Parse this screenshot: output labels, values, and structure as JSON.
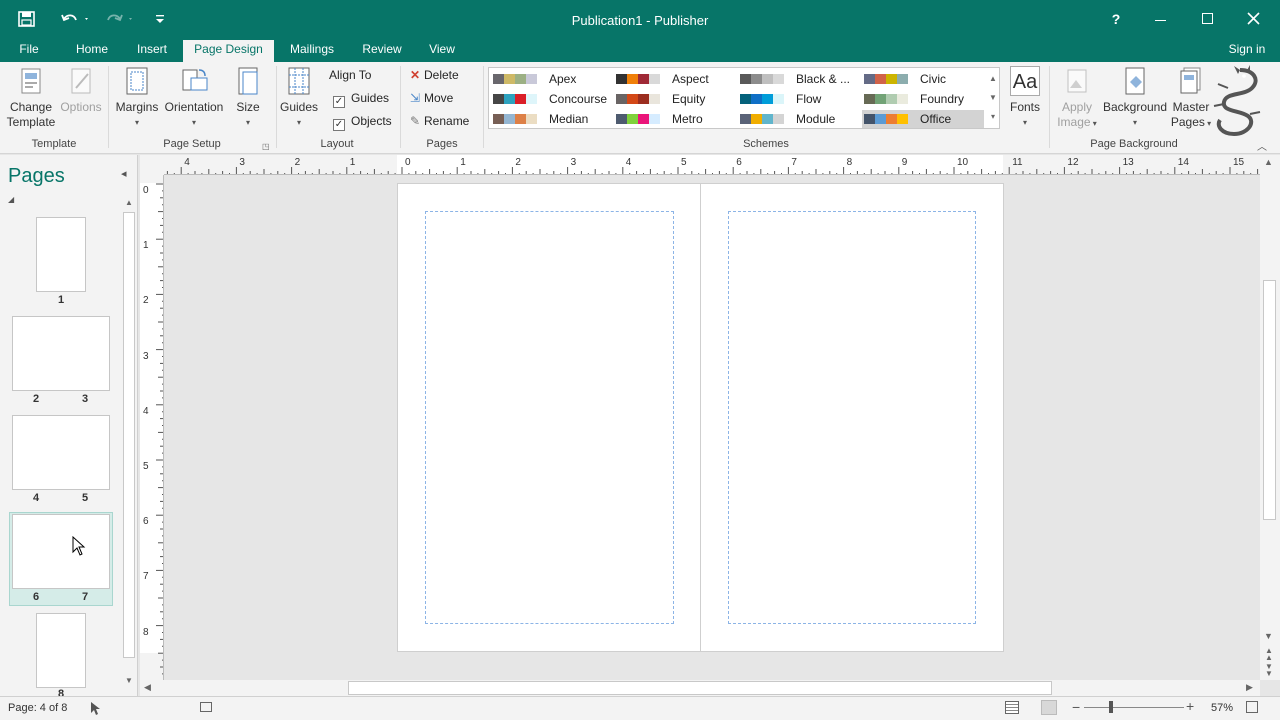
{
  "window": {
    "title": "Publication1 - Publisher"
  },
  "qat": {
    "save": "save-icon",
    "undo": "undo-icon",
    "redo": "redo-icon",
    "customize": "customize-icon"
  },
  "titlebar_buttons": {
    "help": "?"
  },
  "tabs": [
    "File",
    "Home",
    "Insert",
    "Page Design",
    "Mailings",
    "Review",
    "View"
  ],
  "active_tab": "Page Design",
  "signin": "Sign in",
  "ribbon": {
    "template": {
      "change": "Change Template",
      "change1": "Change",
      "change2": "Template",
      "options": "Options",
      "label": "Template"
    },
    "page_setup": {
      "margins": "Margins",
      "orientation": "Orientation",
      "size": "Size",
      "label": "Page Setup"
    },
    "layout": {
      "guides": "Guides",
      "align_to": "Align To",
      "guides_chk": "Guides",
      "objects_chk": "Objects",
      "label": "Layout"
    },
    "pages": {
      "delete": "Delete",
      "move": "Move",
      "rename": "Rename",
      "label": "Pages"
    },
    "schemes": {
      "label": "Schemes",
      "items": [
        {
          "name": "Apex",
          "colors": [
            "#69676d",
            "#ceb966",
            "#9cb084",
            "#c9c9d9"
          ]
        },
        {
          "name": "Aspect",
          "colors": [
            "#323232",
            "#f07f09",
            "#9f2936",
            "#d9d9d9"
          ]
        },
        {
          "name": "Black & ...",
          "colors": [
            "#595959",
            "#8c8c8c",
            "#bfbfbf",
            "#d9d9d9"
          ]
        },
        {
          "name": "Civic",
          "colors": [
            "#646b86",
            "#d16349",
            "#ccb400",
            "#8cadae"
          ]
        },
        {
          "name": "Concourse",
          "colors": [
            "#464646",
            "#2da2bf",
            "#da1f28",
            "#def5fa"
          ]
        },
        {
          "name": "Equity",
          "colors": [
            "#696464",
            "#d34817",
            "#9b2d1f",
            "#e9e5dc"
          ]
        },
        {
          "name": "Flow",
          "colors": [
            "#04617b",
            "#0f6fc6",
            "#009dd9",
            "#dbf5f9"
          ]
        },
        {
          "name": "Foundry",
          "colors": [
            "#676a55",
            "#72a376",
            "#b0ccb0",
            "#eaebde"
          ]
        },
        {
          "name": "Median",
          "colors": [
            "#775f55",
            "#94b6d2",
            "#dd8047",
            "#ebddc3"
          ]
        },
        {
          "name": "Metro",
          "colors": [
            "#4e5b6f",
            "#7fd13b",
            "#ea157a",
            "#d6ecff"
          ]
        },
        {
          "name": "Module",
          "colors": [
            "#5a6378",
            "#f0ad00",
            "#60b5cc",
            "#d4d4d4"
          ]
        },
        {
          "name": "Office",
          "colors": [
            "#44546a",
            "#5b9bd5",
            "#ed7d31",
            "#ffc000"
          ]
        }
      ],
      "selected": "Office"
    },
    "fonts": "Fonts",
    "apply_image": {
      "l1": "Apply",
      "l2": "Image"
    },
    "background": "Background",
    "master_pages": {
      "l1": "Master",
      "l2": "Pages"
    },
    "page_background_label": "Page Background"
  },
  "pages_pane": {
    "title": "Pages",
    "thumbs": [
      {
        "labels": [
          "1"
        ]
      },
      {
        "labels": [
          "2",
          "3"
        ]
      },
      {
        "labels": [
          "4",
          "5"
        ]
      },
      {
        "labels": [
          "6",
          "7"
        ]
      },
      {
        "labels": [
          "8"
        ]
      }
    ]
  },
  "ruler": {
    "h": [
      "4",
      "3",
      "2",
      "1",
      "0",
      "1",
      "2",
      "3",
      "4",
      "5",
      "6",
      "7",
      "8",
      "9",
      "10",
      "11",
      "12",
      "13",
      "14",
      "15"
    ],
    "v": [
      "0",
      "1",
      "2",
      "3",
      "4",
      "5",
      "6",
      "7",
      "8"
    ]
  },
  "status": {
    "page": "Page: 4 of 8",
    "zoom": "57%"
  },
  "colors": {
    "accent": "#077568",
    "guide": "#8cb4e6"
  }
}
